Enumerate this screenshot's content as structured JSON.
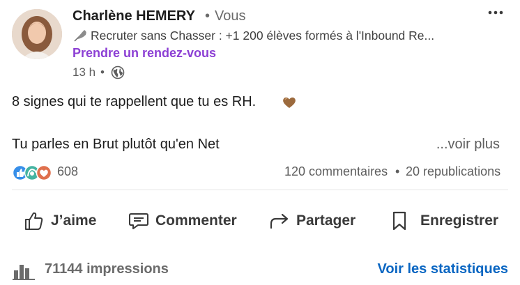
{
  "author": {
    "name": "Charlène HEMERY",
    "separator": "•",
    "degree": "Vous",
    "headline": "Recruter sans Chasser : +1 200 élèves formés à l'Inbound Re...",
    "headline_icon": "feather-icon",
    "cta_link": "Prendre un rendez-vous",
    "time": "13 h",
    "time_separator": "•",
    "visibility_icon": "globe-icon"
  },
  "post": {
    "line1": "8 signes qui te rappellent que tu es RH.",
    "emoji": "brown-heart-emoji",
    "line2": "Tu parles en Brut plutôt qu'en Net",
    "see_more": "...voir plus"
  },
  "social": {
    "reaction_icons": [
      "like-icon",
      "celebrate-icon",
      "love-icon"
    ],
    "reaction_count": "608",
    "comments": "120 commentaires",
    "separator": "•",
    "reposts": "20 republications"
  },
  "actions": {
    "like": "J’aime",
    "comment": "Commenter",
    "share": "Partager",
    "save": "Enregistrer"
  },
  "footer": {
    "impressions": "71144 impressions",
    "stats_link": "Voir les statistiques"
  },
  "colors": {
    "cta": "#8c3fd4",
    "link": "#0a66c2",
    "text": "#1d1d1d",
    "muted": "#5e5e5e"
  }
}
